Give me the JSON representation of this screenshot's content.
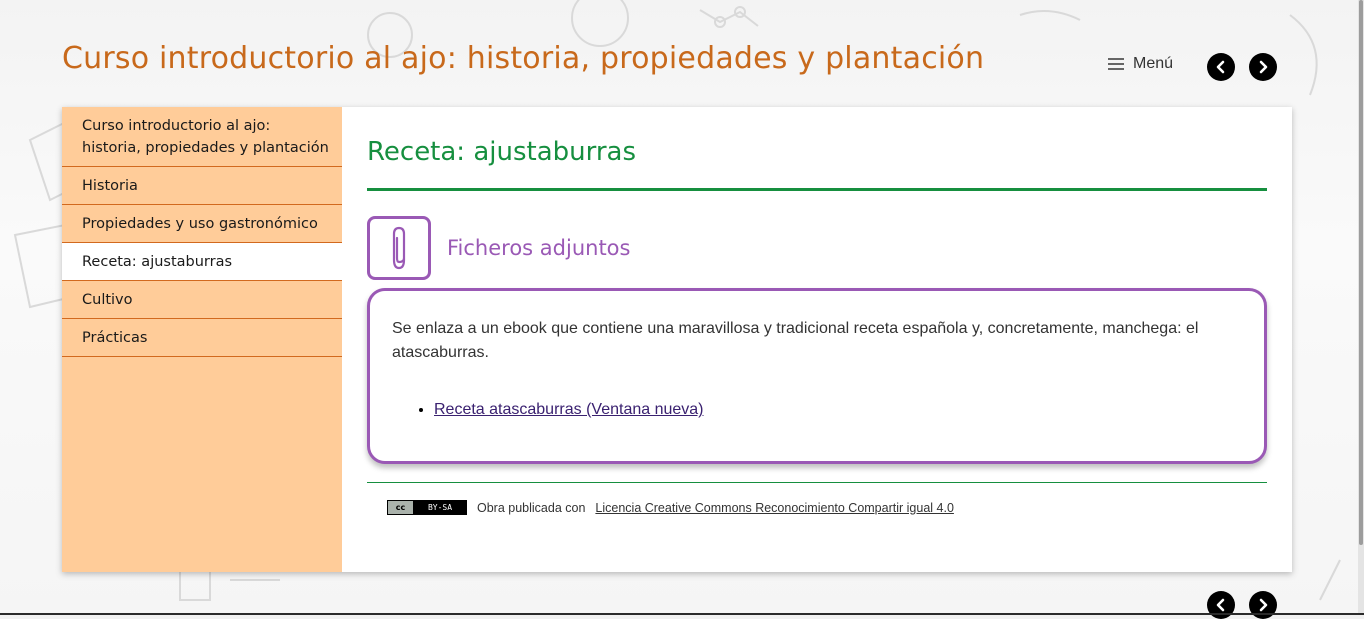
{
  "header": {
    "site_title": "Curso introductorio al ajo: historia, propiedades y plantación",
    "menu_label": "Menú"
  },
  "sidebar": {
    "items": [
      {
        "label": "Curso introductorio al ajo: historia, propiedades y plantación",
        "active": false
      },
      {
        "label": "Historia",
        "active": false
      },
      {
        "label": "Propiedades y uso gastronómico",
        "active": false
      },
      {
        "label": "Receta: ajustaburras",
        "active": true
      },
      {
        "label": "Cultivo",
        "active": false
      },
      {
        "label": "Prácticas",
        "active": false
      }
    ]
  },
  "main": {
    "page_title": "Receta: ajustaburras",
    "attachments": {
      "title": "Ficheros adjuntos",
      "text": "Se enlaza a un ebook que contiene una maravillosa y tradicional receta española y, concretamente, manchega: el atascaburras.",
      "links": [
        "Receta atascaburras (Ventana nueva)"
      ]
    }
  },
  "footer": {
    "license_prefix": "Obra publicada con",
    "license_link": "Licencia Creative Commons Reconocimiento Compartir igual 4.0",
    "badge_cc": "cc",
    "badge_by": "BY-SA"
  },
  "colors": {
    "title_orange": "#c8691b",
    "sidebar_bg": "#ffcc99",
    "green": "#168f3f",
    "purple": "#9a59b5"
  },
  "icons": {
    "prev": "chevron-left-icon",
    "next": "chevron-right-icon",
    "menu": "hamburger-icon",
    "attachment": "paperclip-icon"
  }
}
